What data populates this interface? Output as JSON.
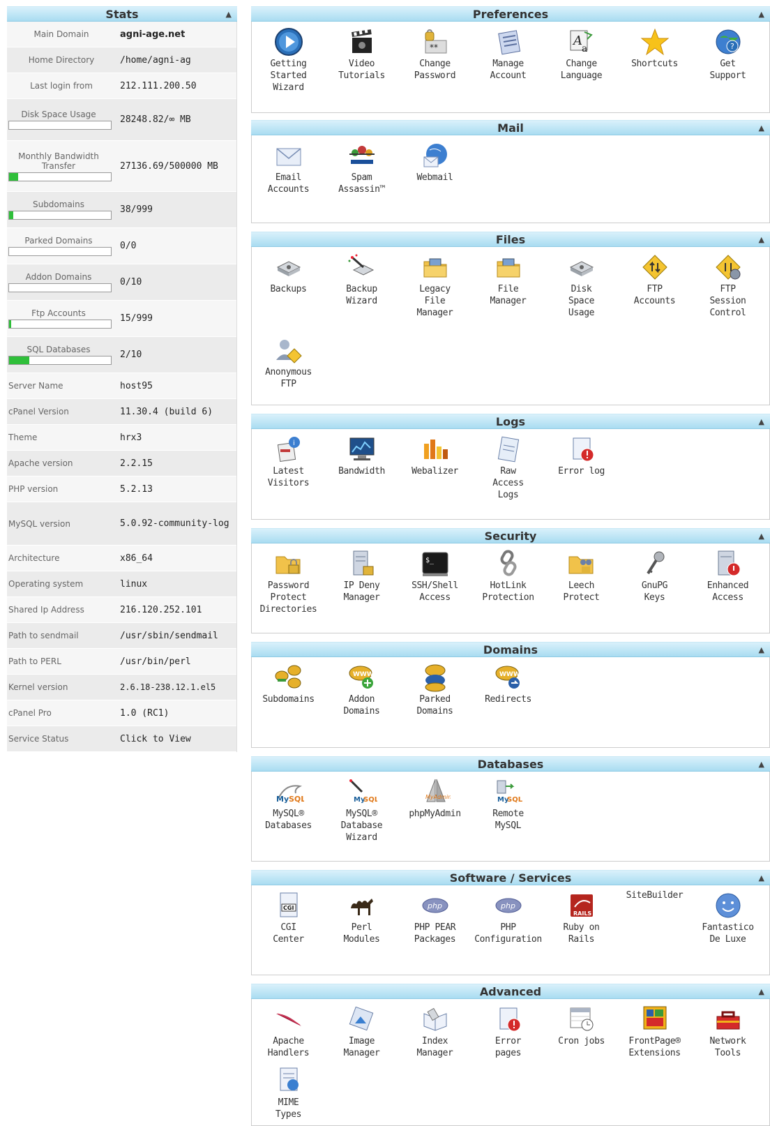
{
  "stats": {
    "title": "Stats",
    "rows": [
      {
        "label": "Main Domain",
        "value": "agni-age.net"
      },
      {
        "label": "Home Directory",
        "value": "/home/agni-ag"
      },
      {
        "label": "Last login from",
        "value": "212.111.200.50"
      },
      {
        "label": "Disk Space Usage",
        "value": "28248.82/∞ MB"
      },
      {
        "label": "Monthly Bandwidth Transfer",
        "value": "27136.69/500000 MB"
      },
      {
        "label": "Subdomains",
        "value": "38/999"
      },
      {
        "label": "Parked Domains",
        "value": "0/0"
      },
      {
        "label": "Addon Domains",
        "value": "0/10"
      },
      {
        "label": "Ftp Accounts",
        "value": "15/999"
      },
      {
        "label": "SQL Databases",
        "value": "2/10"
      },
      {
        "label": "Server Name",
        "value": "host95"
      },
      {
        "label": "cPanel Version",
        "value": "11.30.4 (build 6)"
      },
      {
        "label": "Theme",
        "value": "hrx3"
      },
      {
        "label": "Apache version",
        "value": "2.2.15"
      },
      {
        "label": "PHP version",
        "value": "5.2.13"
      },
      {
        "label": "MySQL version",
        "value": "5.0.92-community-log"
      },
      {
        "label": "Architecture",
        "value": "x86_64"
      },
      {
        "label": "Operating system",
        "value": "linux"
      },
      {
        "label": "Shared Ip Address",
        "value": "216.120.252.101"
      },
      {
        "label": "Path to sendmail",
        "value": "/usr/sbin/sendmail"
      },
      {
        "label": "Path to PERL",
        "value": "/usr/bin/perl"
      },
      {
        "label": "Kernel version",
        "value": "2.6.18-238.12.1.el5"
      },
      {
        "label": "cPanel Pro",
        "value": "1.0 (RC1)"
      },
      {
        "label": "Service Status",
        "value": "Click to View"
      }
    ],
    "gauges": {
      "disk": 0.0,
      "bandwidth": 0.09,
      "subdomains": 0.04,
      "parked": 0.0,
      "addon": 0.0,
      "ftp": 0.02,
      "sql": 0.2
    }
  },
  "sections": [
    {
      "title": "Preferences",
      "items": [
        {
          "label": "Getting\nStarted\nWizard",
          "icon": "play-circle-icon"
        },
        {
          "label": "Video\nTutorials",
          "icon": "film-clapper-icon"
        },
        {
          "label": "Change\nPassword",
          "icon": "lock-password-icon"
        },
        {
          "label": "Manage\nAccount",
          "icon": "account-form-icon"
        },
        {
          "label": "Change\nLanguage",
          "icon": "language-icon"
        },
        {
          "label": "Shortcuts",
          "icon": "star-icon"
        },
        {
          "label": "Get\nSupport",
          "icon": "support-globe-icon"
        }
      ]
    },
    {
      "title": "Mail",
      "items": [
        {
          "label": "Email\nAccounts",
          "icon": "envelope-icon"
        },
        {
          "label": "Spam\nAssassin™",
          "icon": "spam-assassin-icon"
        },
        {
          "label": "Webmail",
          "icon": "webmail-globe-icon"
        }
      ]
    },
    {
      "title": "Files",
      "items": [
        {
          "label": "Backups",
          "icon": "disk-drive-icon"
        },
        {
          "label": "Backup\nWizard",
          "icon": "backup-wand-icon"
        },
        {
          "label": "Legacy\nFile\nManager",
          "icon": "folder-icon"
        },
        {
          "label": "File\nManager",
          "icon": "folder-icon"
        },
        {
          "label": "Disk\nSpace\nUsage",
          "icon": "disk-drive-icon"
        },
        {
          "label": "FTP\nAccounts",
          "icon": "ftp-arrows-icon"
        },
        {
          "label": "FTP\nSession\nControl",
          "icon": "ftp-gear-icon"
        },
        {
          "label": "Anonymous\nFTP",
          "icon": "anonymous-user-icon"
        }
      ]
    },
    {
      "title": "Logs",
      "items": [
        {
          "label": "Latest\nVisitors",
          "icon": "visitors-icon"
        },
        {
          "label": "Bandwidth",
          "icon": "monitor-chart-icon"
        },
        {
          "label": "Webalizer",
          "icon": "bar-chart-icon"
        },
        {
          "label": "Raw\nAccess\nLogs",
          "icon": "document-page-icon"
        },
        {
          "label": "Error log",
          "icon": "error-page-icon"
        }
      ]
    },
    {
      "title": "Security",
      "items": [
        {
          "label": "Password\nProtect\nDirectories",
          "icon": "folder-lock-icon"
        },
        {
          "label": "IP Deny\nManager",
          "icon": "server-lock-icon"
        },
        {
          "label": "SSH/Shell\nAccess",
          "icon": "terminal-icon"
        },
        {
          "label": "HotLink\nProtection",
          "icon": "chain-link-icon"
        },
        {
          "label": "Leech\nProtect",
          "icon": "folder-users-icon"
        },
        {
          "label": "GnuPG\nKeys",
          "icon": "keys-icon"
        },
        {
          "label": "Enhanced\nAccess",
          "icon": "server-stop-icon"
        }
      ]
    },
    {
      "title": "Domains",
      "items": [
        {
          "label": "Subdomains",
          "icon": "www-multi-icon"
        },
        {
          "label": "Addon\nDomains",
          "icon": "www-plus-icon"
        },
        {
          "label": "Parked\nDomains",
          "icon": "www-stack-icon"
        },
        {
          "label": "Redirects",
          "icon": "www-redirect-icon"
        }
      ]
    },
    {
      "title": "Databases",
      "items": [
        {
          "label": "MySQL®\nDatabases",
          "icon": "mysql-dolphin-icon"
        },
        {
          "label": "MySQL®\nDatabase\nWizard",
          "icon": "mysql-wand-icon"
        },
        {
          "label": "phpMyAdmin",
          "icon": "phpmyadmin-sail-icon"
        },
        {
          "label": "Remote\nMySQL",
          "icon": "mysql-remote-icon"
        }
      ]
    },
    {
      "title": "Software / Services",
      "items": [
        {
          "label": "CGI\nCenter",
          "icon": "cgi-doc-icon"
        },
        {
          "label": "Perl\nModules",
          "icon": "camel-icon"
        },
        {
          "label": "PHP PEAR\nPackages",
          "icon": "php-logo-icon"
        },
        {
          "label": "PHP\nConfiguration",
          "icon": "php-logo-icon"
        },
        {
          "label": "Ruby on\nRails",
          "icon": "rails-icon"
        },
        {
          "label": "SiteBuilder",
          "icon": "",
          "textonly": true
        },
        {
          "label": "Fantastico\nDe Luxe",
          "icon": "smiley-icon"
        }
      ]
    },
    {
      "title": "Advanced",
      "items": [
        {
          "label": "Apache\nHandlers",
          "icon": "apache-feather-icon"
        },
        {
          "label": "Image\nManager",
          "icon": "image-tile-icon"
        },
        {
          "label": "Index\nManager",
          "icon": "open-book-icon"
        },
        {
          "label": "Error\npages",
          "icon": "error-page-icon"
        },
        {
          "label": "Cron jobs",
          "icon": "calendar-clock-icon"
        },
        {
          "label": "FrontPage®\nExtensions",
          "icon": "frontpage-icon"
        },
        {
          "label": "Network\nTools",
          "icon": "toolbox-icon"
        },
        {
          "label": "MIME\nTypes",
          "icon": "mime-doc-icon"
        }
      ]
    }
  ]
}
